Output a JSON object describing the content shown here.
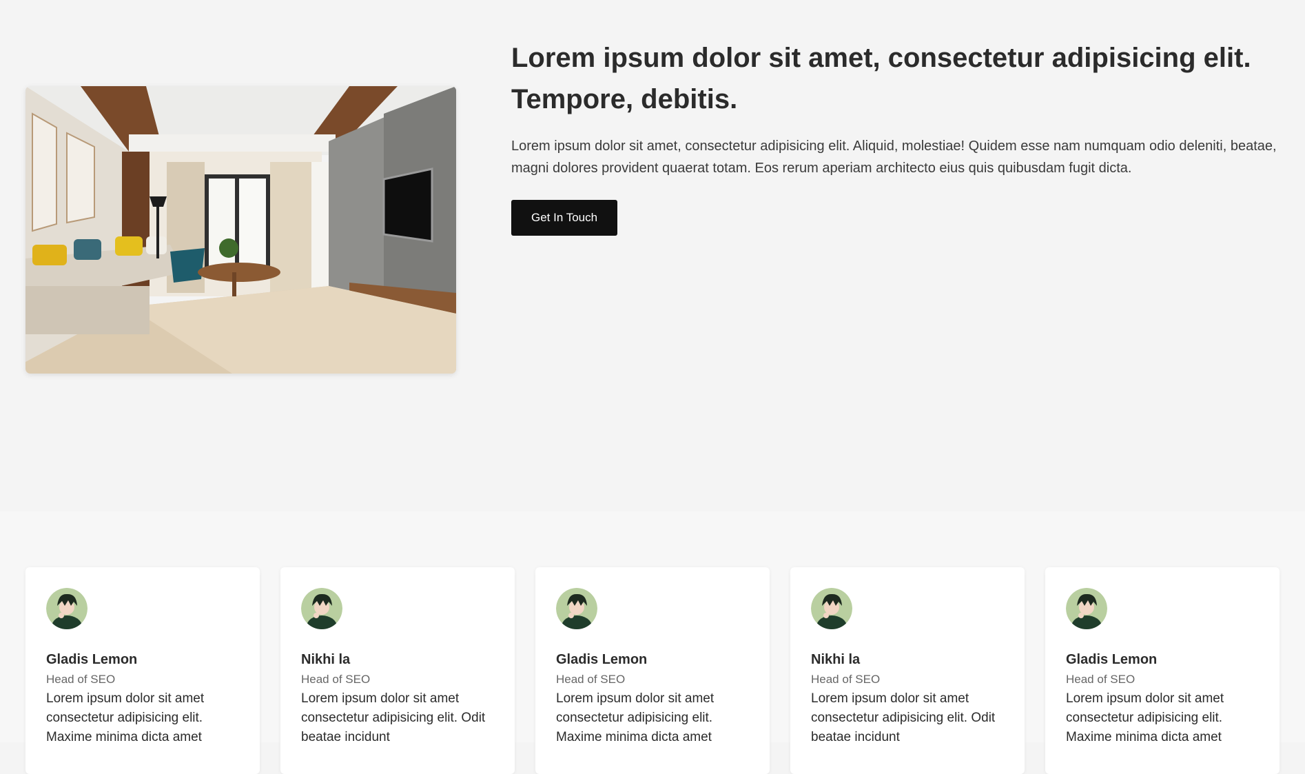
{
  "hero": {
    "image": "living-room-photo",
    "title": "Lorem ipsum dolor sit amet, consectetur adipisicing elit. Tempore, debitis.",
    "text": "Lorem ipsum dolor sit amet, consectetur adipisicing elit. Aliquid, molestiae! Quidem esse nam numquam odio deleniti, beatae, magni dolores provident quaerat totam. Eos rerum aperiam architecto eius quis quibusdam fugit dicta.",
    "button_label": "Get In Touch"
  },
  "team": {
    "cards": [
      {
        "name": "Gladis Lemon",
        "role": "Head of SEO",
        "text": "Lorem ipsum dolor sit amet consectetur adipisicing elit. Maxime minima dicta amet"
      },
      {
        "name": "Nikhi la",
        "role": "Head of SEO",
        "text": "Lorem ipsum dolor sit amet consectetur adipisicing elit. Odit beatae incidunt"
      },
      {
        "name": "Gladis Lemon",
        "role": "Head of SEO",
        "text": "Lorem ipsum dolor sit amet consectetur adipisicing elit. Maxime minima dicta amet"
      },
      {
        "name": "Nikhi la",
        "role": "Head of SEO",
        "text": "Lorem ipsum dolor sit amet consectetur adipisicing elit. Odit beatae incidunt"
      },
      {
        "name": "Gladis Lemon",
        "role": "Head of SEO",
        "text": "Lorem ipsum dolor sit amet consectetur adipisicing elit. Maxime minima dicta amet"
      }
    ]
  },
  "colors": {
    "background": "#f4f4f4",
    "button": "#111111",
    "text": "#2b2b2b"
  }
}
